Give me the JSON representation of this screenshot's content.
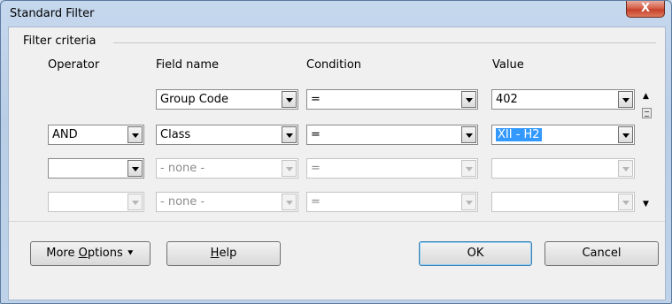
{
  "window": {
    "title": "Standard Filter",
    "close_label": "X"
  },
  "criteria": {
    "legend": "Filter criteria",
    "headers": {
      "operator": "Operator",
      "field": "Field name",
      "condition": "Condition",
      "value": "Value"
    },
    "rows": [
      {
        "operator": "",
        "field": "Group Code",
        "condition": "=",
        "value": "402"
      },
      {
        "operator": "AND",
        "field": "Class",
        "condition": "=",
        "value": "XII - H2"
      },
      {
        "operator": "",
        "field": "- none -",
        "condition": "=",
        "value": ""
      },
      {
        "operator": "",
        "field": "- none -",
        "condition": "=",
        "value": ""
      }
    ]
  },
  "buttons": {
    "more_options_prefix": "More ",
    "more_options_key": "O",
    "more_options_rest": "ptions",
    "more_options_arrow": "⯆",
    "help_key": "H",
    "help_rest": "elp",
    "ok": "OK",
    "cancel": "Cancel"
  },
  "icons": {
    "scroll_up": "▲",
    "scroll_down": "▼"
  }
}
